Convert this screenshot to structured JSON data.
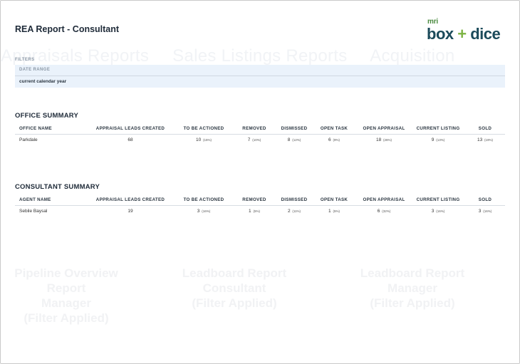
{
  "report": {
    "title": "REA Report - Consultant"
  },
  "logo": {
    "mri": "mri",
    "box": "box",
    "plus": "+",
    "dice": "dice"
  },
  "watermark": {
    "band": [
      "Appraisals Reports",
      "Sales Listings Reports",
      "Acquisition"
    ],
    "blocks": [
      {
        "line1": "Pipeline Overview Report",
        "line2": "Manager",
        "line3": "(Filter Applied)"
      },
      {
        "line1": "Leadboard Report",
        "line2": "Consultant",
        "line3": "(Filter Applied)"
      },
      {
        "line1": "Leadboard Report",
        "line2": "Manager",
        "line3": "(Filter Applied)"
      }
    ]
  },
  "filters": {
    "label": "FILTERS",
    "date_range_label": "DATE RANGE",
    "date_range_value": "current calendar year"
  },
  "office_summary": {
    "title": "OFFICE SUMMARY",
    "columns": [
      "OFFICE NAME",
      "APPRAISAL LEADS CREATED",
      "TO BE ACTIONED",
      "REMOVED",
      "DISMISSED",
      "OPEN TASK",
      "OPEN APPRAISAL",
      "CURRENT LISTING",
      "SOLD"
    ],
    "rows": [
      {
        "name": "Parkdale",
        "leads": "68",
        "to_be_actioned": "10",
        "to_be_actioned_pct": "(15%)",
        "removed": "7",
        "removed_pct": "(10%)",
        "dismissed": "8",
        "dismissed_pct": "(12%)",
        "open_task": "6",
        "open_task_pct": "(9%)",
        "open_appraisal": "18",
        "open_appraisal_pct": "(26%)",
        "current_listing": "9",
        "current_listing_pct": "(13%)",
        "sold": "13",
        "sold_pct": "(19%)"
      }
    ]
  },
  "consultant_summary": {
    "title": "CONSULTANT SUMMARY",
    "columns": [
      "AGENT NAME",
      "APPRAISAL LEADS CREATED",
      "TO BE ACTIONED",
      "REMOVED",
      "DISMISSED",
      "OPEN TASK",
      "OPEN APPRAISAL",
      "CURRENT LISTING",
      "SOLD"
    ],
    "rows": [
      {
        "name": "Sebile Baysal",
        "leads": "19",
        "to_be_actioned": "3",
        "to_be_actioned_pct": "(16%)",
        "removed": "1",
        "removed_pct": "(5%)",
        "dismissed": "2",
        "dismissed_pct": "(11%)",
        "open_task": "1",
        "open_task_pct": "(5%)",
        "open_appraisal": "6",
        "open_appraisal_pct": "(32%)",
        "current_listing": "3",
        "current_listing_pct": "(16%)",
        "sold": "3",
        "sold_pct": "(16%)"
      }
    ]
  },
  "colors": {
    "title": "#1e2a38",
    "filter_bg": "#eaf2fb",
    "logo_teal": "#1b4a5a",
    "logo_green": "#7cb342"
  }
}
